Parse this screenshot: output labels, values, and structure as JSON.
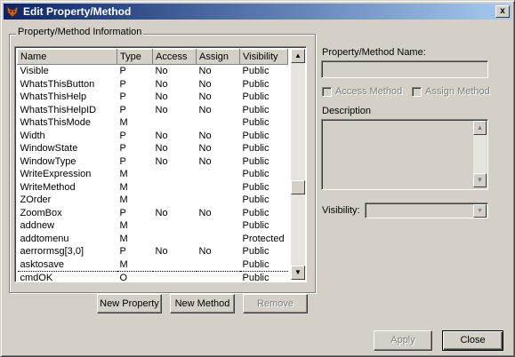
{
  "window": {
    "title": "Edit Property/Method",
    "close_glyph": "x",
    "app_icon": "fox-icon"
  },
  "group": {
    "label": "Property/Method Information"
  },
  "grid": {
    "columns": [
      "Name",
      "Type",
      "Access",
      "Assign",
      "Visibility"
    ],
    "rows": [
      [
        "Visible",
        "P",
        "No",
        "No",
        "Public"
      ],
      [
        "WhatsThisButton",
        "P",
        "No",
        "No",
        "Public"
      ],
      [
        "WhatsThisHelp",
        "P",
        "No",
        "No",
        "Public"
      ],
      [
        "WhatsThisHelpID",
        "P",
        "No",
        "No",
        "Public"
      ],
      [
        "WhatsThisMode",
        "M",
        "",
        "",
        "Public"
      ],
      [
        "Width",
        "P",
        "No",
        "No",
        "Public"
      ],
      [
        "WindowState",
        "P",
        "No",
        "No",
        "Public"
      ],
      [
        "WindowType",
        "P",
        "No",
        "No",
        "Public"
      ],
      [
        "WriteExpression",
        "M",
        "",
        "",
        "Public"
      ],
      [
        "WriteMethod",
        "M",
        "",
        "",
        "Public"
      ],
      [
        "ZOrder",
        "M",
        "",
        "",
        "Public"
      ],
      [
        "ZoomBox",
        "P",
        "No",
        "No",
        "Public"
      ],
      [
        "addnew",
        "M",
        "",
        "",
        "Public"
      ],
      [
        "addtomenu",
        "M",
        "",
        "",
        "Protected"
      ],
      [
        "aerrormsg[3,0]",
        "P",
        "No",
        "No",
        "Public"
      ],
      [
        "asktosave",
        "M",
        "",
        "",
        "Public"
      ],
      [
        "cmdOK",
        "O",
        "",
        "",
        "Public"
      ]
    ],
    "selected_row": 16,
    "scroll_up_glyph": "▲",
    "scroll_down_glyph": "▼"
  },
  "buttons": {
    "new_property": "New Property",
    "new_method": "New Method",
    "remove": "Remove",
    "apply": "Apply",
    "close": "Close"
  },
  "details": {
    "name_label": "Property/Method Name:",
    "name_value": "",
    "access_method_label": "Access Method",
    "assign_method_label": "Assign Method",
    "description_label": "Description",
    "description_value": "",
    "visibility_label": "Visibility:",
    "visibility_value": ""
  }
}
